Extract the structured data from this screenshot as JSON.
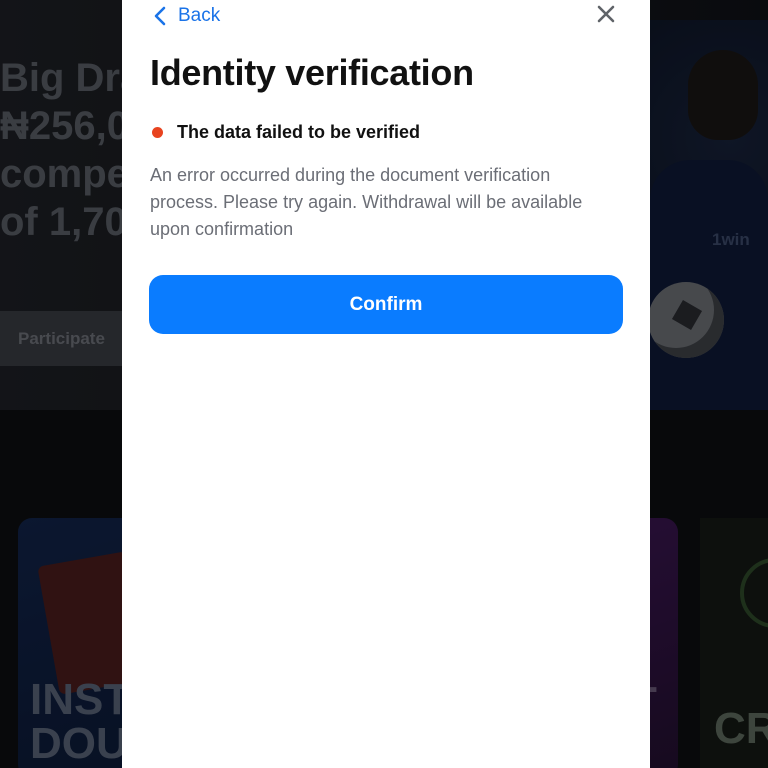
{
  "background": {
    "hero_lines": [
      "Big Dra",
      "₦256,0",
      "compe",
      "of 1,70"
    ],
    "participate_label": "Participate",
    "player_logo": "1win",
    "card_left_lines": [
      "INST",
      "DOU"
    ],
    "card_right_letter": "T",
    "card_far_letters": "CR"
  },
  "modal": {
    "back_label": "Back",
    "title": "Identity verification",
    "status": {
      "text": "The data failed to be verified",
      "color": "#e8431f"
    },
    "message": "An error occurred during the document verification process. Please try again. Withdrawal will be available upon confirmation",
    "confirm_label": "Confirm",
    "accent_color": "#0a7cff"
  },
  "icons": {
    "back": "chevron-left-icon",
    "close": "close-icon"
  }
}
